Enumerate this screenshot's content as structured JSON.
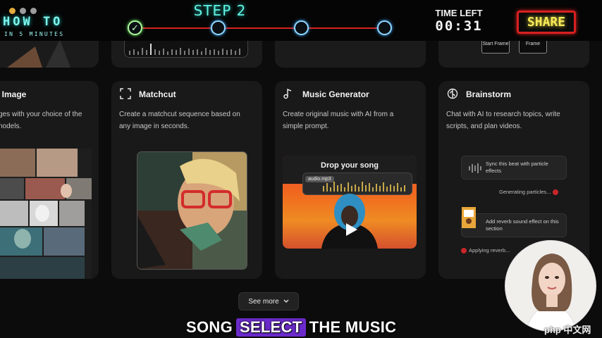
{
  "banner": {
    "dot_colors": [
      "#e2a93b",
      "#9c9c9c",
      "#9c9c9c"
    ],
    "title": "HOW TO",
    "subtitle": "IN 5 MINUTES",
    "step_title": "STEP 2",
    "step_check": "✓",
    "time_label": "TIME LEFT",
    "time_value": "00:31",
    "share_label": "SHARE"
  },
  "top_strip": {
    "start_frame": "Start Frame",
    "end_frame": "Frame"
  },
  "cards": [
    {
      "icon": "image-icon",
      "title": "o Image",
      "description": "ges with your choice of the\nnodels."
    },
    {
      "icon": "matchcut-icon",
      "title": "Matchcut",
      "description": "Create a matchcut sequence based on\nany image in seconds."
    },
    {
      "icon": "music-note-icon",
      "title": "Music Generator",
      "description": "Create original music with AI from a\nsimple prompt.",
      "drop_label": "Drop your song",
      "audio_file": "audio.mp3"
    },
    {
      "icon": "brain-icon",
      "title": "Brainstorm",
      "description": "Chat with AI to research topics, write\nscripts, and plan videos.",
      "chat_1": "Sync this beat with particle effects",
      "status_1": "Generating particles...",
      "chat_2": "Add reverb sound effect on this section",
      "status_2": "Applying reverb..."
    }
  ],
  "see_more_label": "See more",
  "caption": {
    "before": "SONG",
    "highlight": "SELECT",
    "after": "THE MUSIC"
  },
  "watermark": "php 中文网",
  "colors": {
    "accent_cyan": "#62f2e2",
    "step_line": "#d3241f",
    "share_text": "#f7ea58",
    "caption_highlight": "#6b2bcc"
  }
}
